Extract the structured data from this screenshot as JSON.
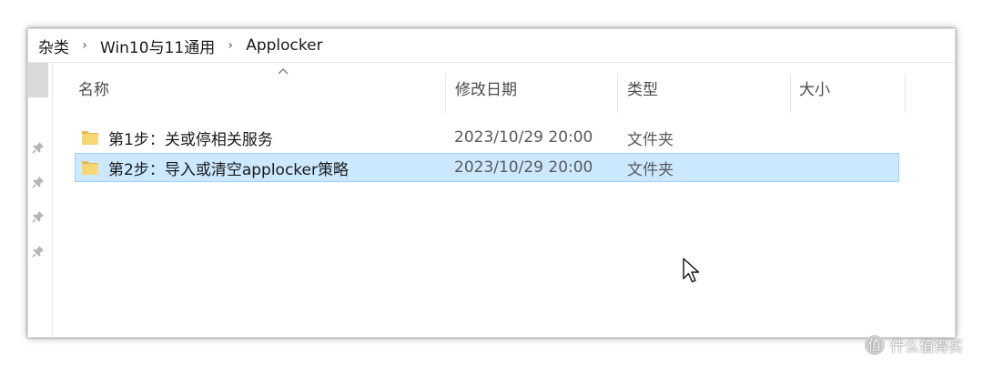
{
  "breadcrumb": {
    "items": [
      "杂类",
      "Win10与11通用",
      "Applocker"
    ],
    "separator": "›"
  },
  "columns": {
    "name": "名称",
    "date": "修改日期",
    "type": "类型",
    "size": "大小"
  },
  "rows": [
    {
      "name": "第1步：关或停相关服务",
      "date": "2023/10/29 20:00",
      "type": "文件夹",
      "size": "",
      "selected": false
    },
    {
      "name": "第2步：导入或清空applocker策略",
      "date": "2023/10/29 20:00",
      "type": "文件夹",
      "size": "",
      "selected": true
    }
  ],
  "watermark": {
    "badge": "值",
    "text": "什么值得买"
  },
  "colors": {
    "selection_bg": "#cce8ff",
    "selection_border": "#99d1ff",
    "folder": "#f8d775"
  },
  "icons": [
    "chevron-right-icon",
    "sort-up-caret-icon",
    "pin-icon",
    "folder-icon",
    "mouse-cursor-icon"
  ]
}
